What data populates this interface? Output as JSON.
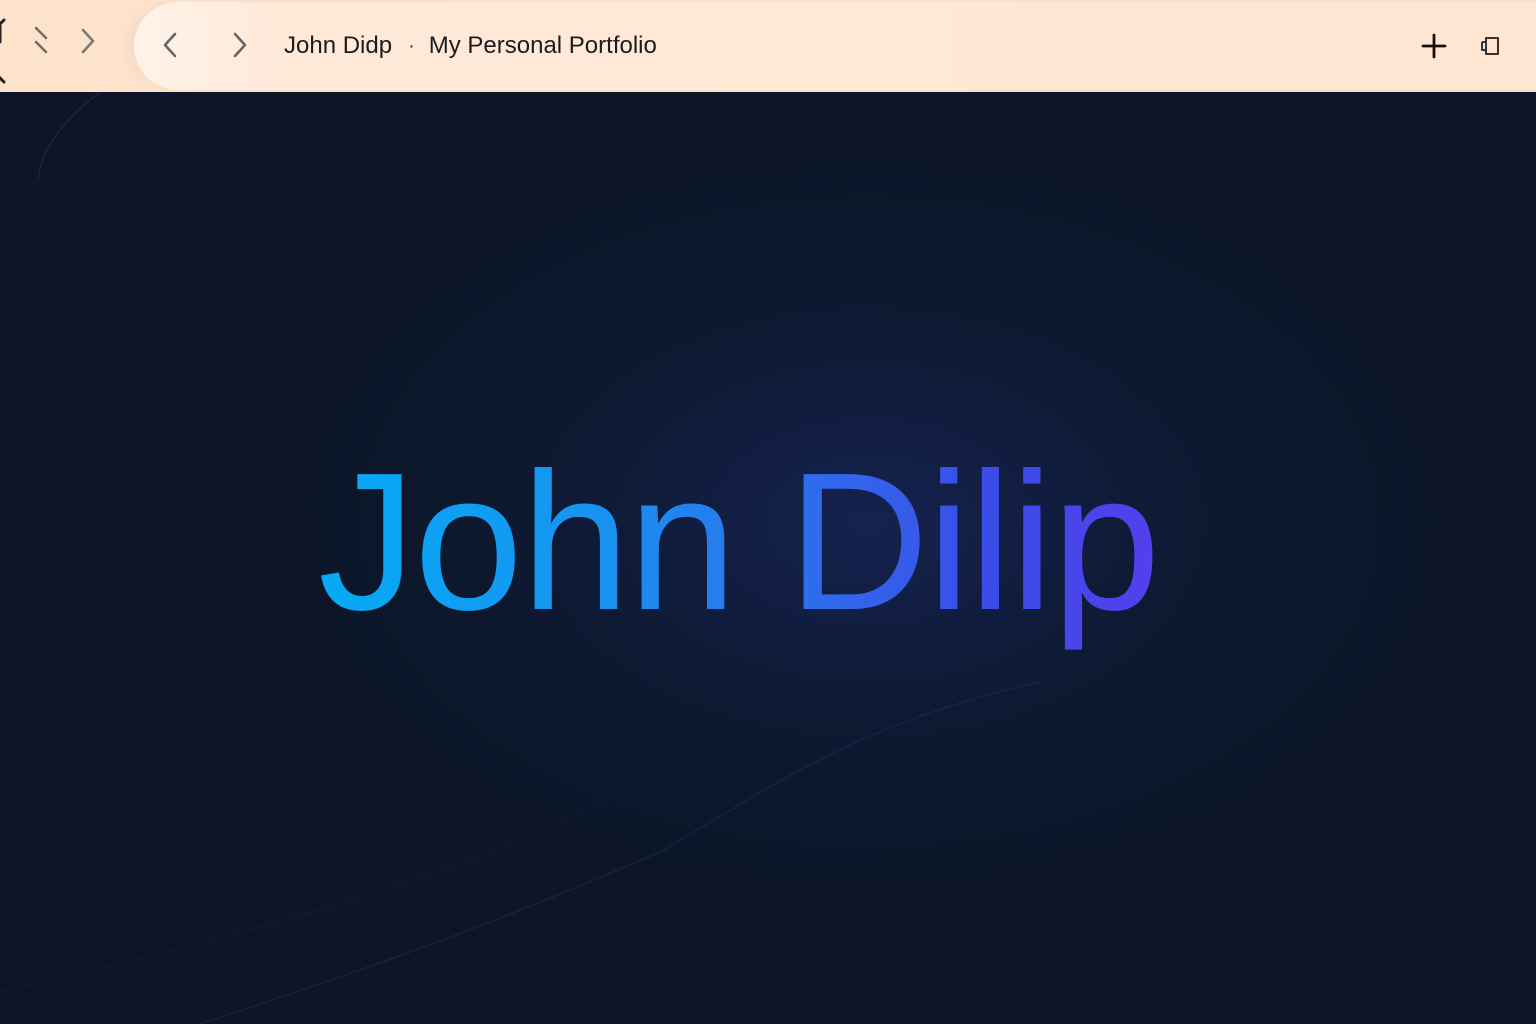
{
  "browser": {
    "tab": {
      "title": "John Didp",
      "separator": "·",
      "subtitle": "My Personal Portfolio"
    },
    "icons": {
      "outer_back": "chevron-lines-icon",
      "outer_forward": "chevron-right-icon",
      "back": "chevron-left-icon",
      "forward": "chevron-right-icon",
      "new_tab": "plus-icon",
      "window": "restore-window-icon"
    },
    "colors": {
      "chrome": "#fde4cf",
      "page_background": "#0c1628"
    }
  },
  "page": {
    "hero_name": "John Dilip",
    "colors": {
      "gradient_start": "#06aaf5",
      "gradient_mid": "#2f6cec",
      "gradient_end": "#5b3cf0"
    }
  }
}
